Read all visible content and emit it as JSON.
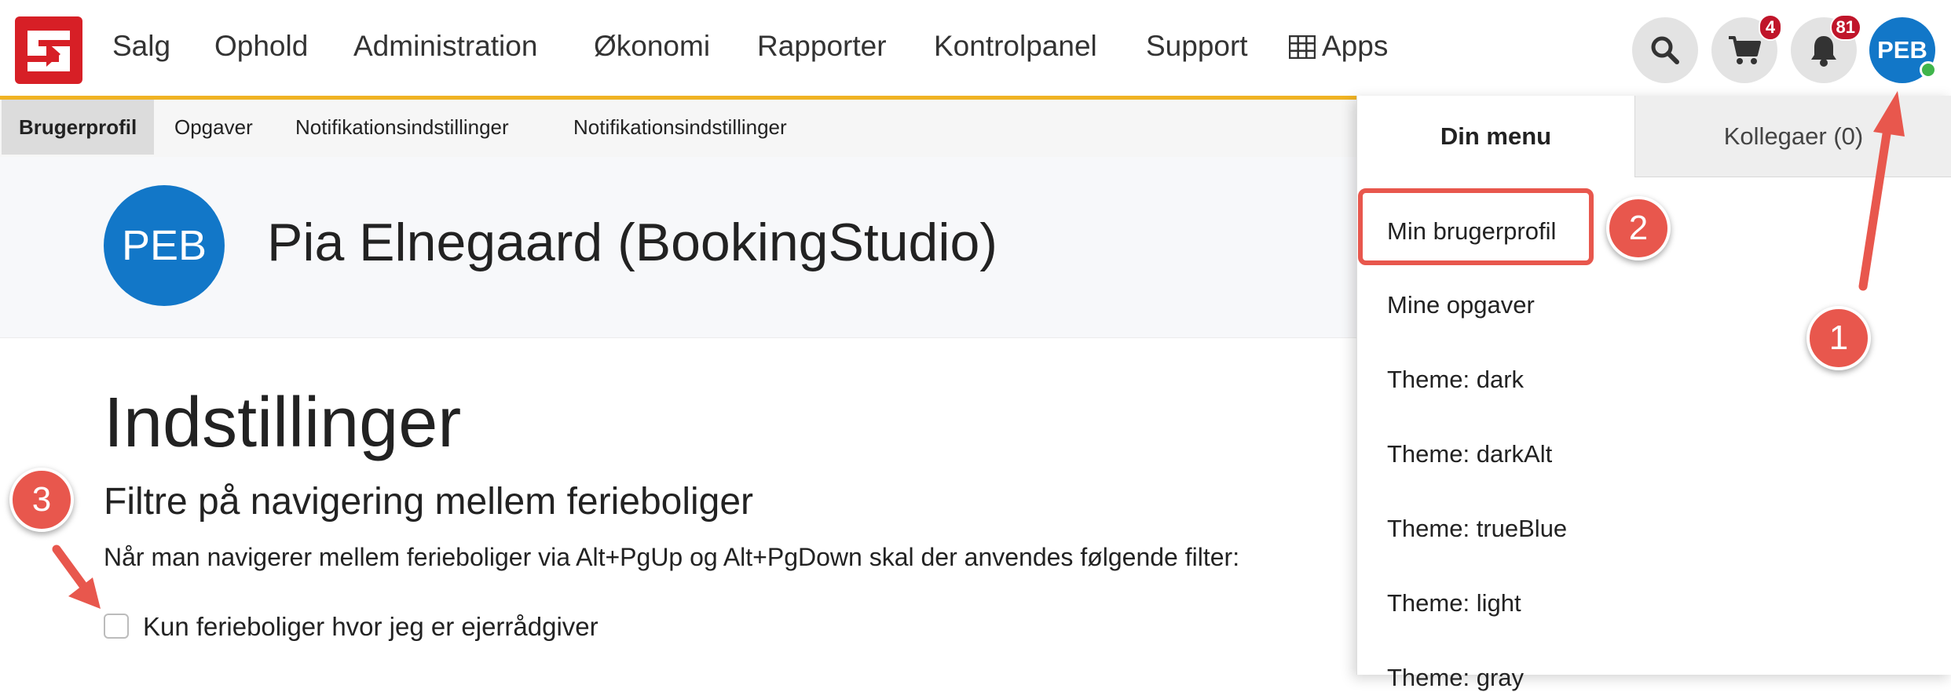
{
  "topnav": {
    "items": [
      "Salg",
      "Ophold",
      "Administration",
      "Økonomi",
      "Rapporter",
      "Kontrolpanel",
      "Support"
    ],
    "apps_label": "Apps",
    "cart_badge": "4",
    "notifications_badge": "81",
    "user_initials": "PEB"
  },
  "subnav": {
    "tabs": [
      "Brugerprofil",
      "Opgaver",
      "Notifikationsindstillinger",
      "Notifikationsindstillinger"
    ],
    "active_index": 0
  },
  "profile": {
    "initials": "PEB",
    "name": "Pia Elnegaard (BookingStudio)"
  },
  "settings": {
    "title": "Indstillinger",
    "section_title": "Filtre på navigering mellem ferieboliger",
    "description": "Når man navigerer mellem ferieboliger via Alt+PgUp og Alt+PgDown skal der anvendes følgende filter:",
    "checkbox_label": "Kun ferieboliger hvor jeg er ejerrådgiver",
    "checkbox_checked": false
  },
  "user_menu": {
    "tabs": [
      "Din menu",
      "Kollegaer (0)"
    ],
    "items": [
      "Min brugerprofil",
      "Mine opgaver",
      "Theme: dark",
      "Theme: darkAlt",
      "Theme: trueBlue",
      "Theme: light",
      "Theme: gray"
    ]
  },
  "annotations": {
    "markers": [
      "1",
      "2",
      "3"
    ],
    "color": "#e8574d"
  },
  "colors": {
    "brand_red": "#d71f26",
    "accent_yellow": "#f0b323",
    "avatar_blue": "#1277c8",
    "badge_red": "#c0152a",
    "online_green": "#3fb54b"
  }
}
